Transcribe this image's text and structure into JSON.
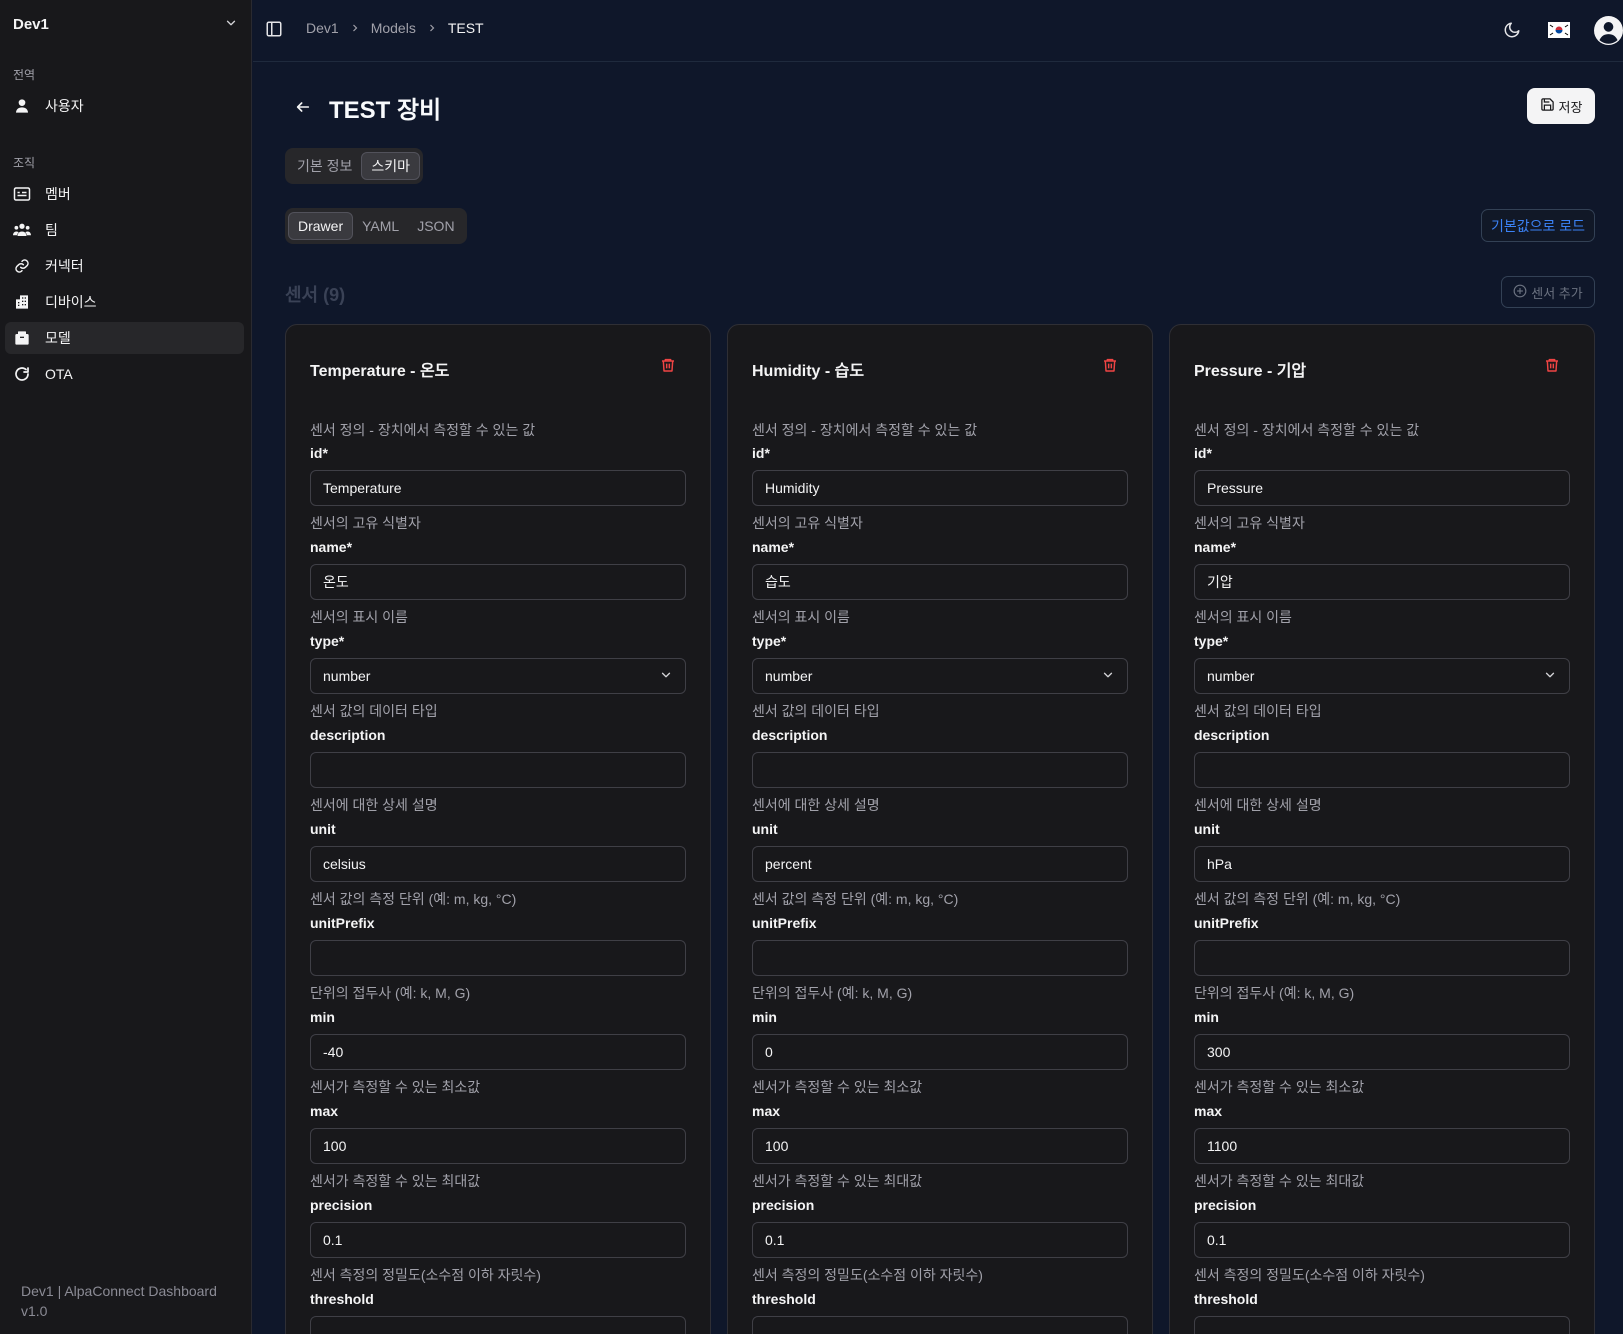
{
  "sidebar": {
    "workspace": "Dev1",
    "global_label": "전역",
    "org_label": "조직",
    "items": [
      {
        "label": "사용자"
      },
      {
        "label": "멤버"
      },
      {
        "label": "팀"
      },
      {
        "label": "커넥터"
      },
      {
        "label": "디바이스"
      },
      {
        "label": "모델"
      },
      {
        "label": "OTA"
      }
    ],
    "footer_line1": "Dev1 | AlpaConnect Dashboard",
    "footer_line2": "v1.0"
  },
  "topbar": {
    "breadcrumbs": [
      "Dev1",
      "Models",
      "TEST"
    ]
  },
  "header": {
    "title": "TEST 장비",
    "save_label": "저장"
  },
  "tabs": {
    "main": [
      "기본 정보",
      "스키마"
    ],
    "main_active": "스키마",
    "view": [
      "Drawer",
      "YAML",
      "JSON"
    ],
    "view_active": "Drawer"
  },
  "load_default_label": "기본값으로 로드",
  "sensors_section": {
    "title": "센서 (9)",
    "add_label": "센서 추가"
  },
  "field_labels": {
    "definition": "센서 정의 - 장치에서 측정할 수 있는 값",
    "id": "id*",
    "id_help": "센서의 고유 식별자",
    "name": "name*",
    "name_help": "센서의 표시 이름",
    "type": "type*",
    "type_help": "센서 값의 데이터 타입",
    "description": "description",
    "description_help": "센서에 대한 상세 설명",
    "unit": "unit",
    "unit_help": "센서 값의 측정 단위 (예: m, kg, °C)",
    "unitPrefix": "unitPrefix",
    "unitPrefix_help": "단위의 접두사 (예: k, M, G)",
    "min": "min",
    "min_help": "센서가 측정할 수 있는 최소값",
    "max": "max",
    "max_help": "센서가 측정할 수 있는 최대값",
    "precision": "precision",
    "precision_help": "센서 측정의 정밀도(소수점 이하 자릿수)",
    "threshold": "threshold"
  },
  "sensors": [
    {
      "title": "Temperature - 온도",
      "id": "Temperature",
      "name": "온도",
      "type": "number",
      "description": "",
      "unit": "celsius",
      "unitPrefix": "",
      "min": "-40",
      "max": "100",
      "precision": "0.1",
      "threshold": ""
    },
    {
      "title": "Humidity - 습도",
      "id": "Humidity",
      "name": "습도",
      "type": "number",
      "description": "",
      "unit": "percent",
      "unitPrefix": "",
      "min": "0",
      "max": "100",
      "precision": "0.1",
      "threshold": ""
    },
    {
      "title": "Pressure - 기압",
      "id": "Pressure",
      "name": "기압",
      "type": "number",
      "description": "",
      "unit": "hPa",
      "unitPrefix": "",
      "min": "300",
      "max": "1100",
      "precision": "0.1",
      "threshold": ""
    }
  ],
  "colors": {
    "background": "#0f172a",
    "sidebar": "#18181b",
    "accent": "#3b82f6",
    "danger": "#ef4444"
  }
}
